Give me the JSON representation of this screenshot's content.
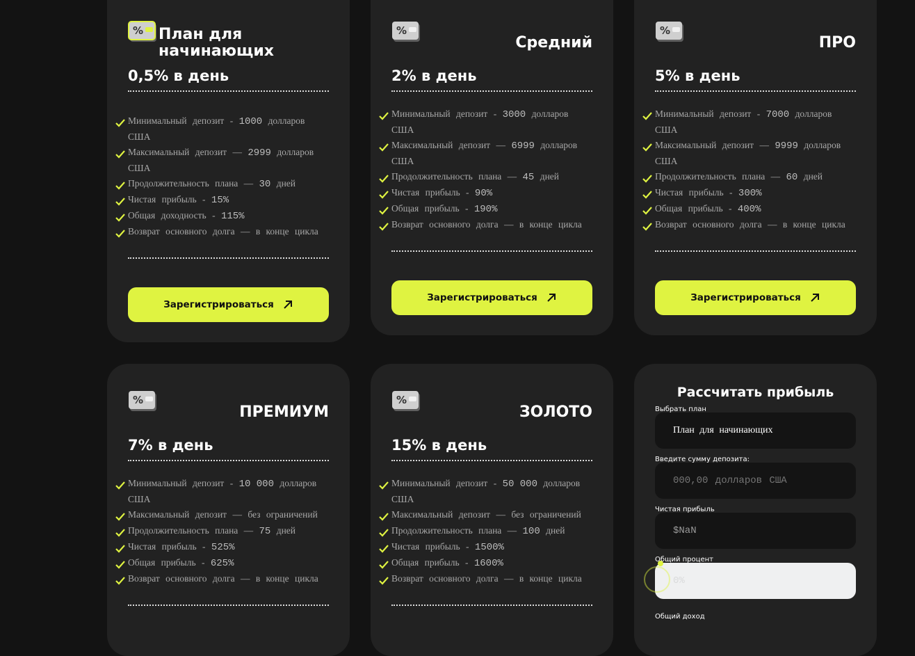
{
  "cta_label": "Зарегистрироваться",
  "accent_color": "#dff341",
  "plans": [
    {
      "name": "План для начинающих",
      "name_lines": [
        "План для",
        "начинающих"
      ],
      "rate": "0,5% в день",
      "features": [
        {
          "text": "Минимальный депозит - ",
          "value": "1000",
          "suffix": " долларов США"
        },
        {
          "text": "Максимальный депозит — ",
          "value": "2999",
          "suffix": " долларов США"
        },
        {
          "text": "Продолжительность плана — ",
          "value": "30",
          "suffix": " дней"
        },
        {
          "text": "Чистая прибыль - ",
          "value": "15%",
          "suffix": ""
        },
        {
          "text": "Общая доходность - ",
          "value": "115%",
          "suffix": ""
        },
        {
          "text": "Возврат основного долга — в конце цикла",
          "value": "",
          "suffix": ""
        }
      ]
    },
    {
      "name": "Средний",
      "rate": "2% в день",
      "features": [
        {
          "text": "Минимальный депозит - ",
          "value": "3000",
          "suffix": " долларов США"
        },
        {
          "text": "Максимальный депозит — ",
          "value": "6999",
          "suffix": " долларов США"
        },
        {
          "text": "Продолжительность плана — ",
          "value": "45",
          "suffix": " дней"
        },
        {
          "text": "Чистая прибыль - ",
          "value": "90%",
          "suffix": ""
        },
        {
          "text": "Общая прибыль - ",
          "value": "190%",
          "suffix": ""
        },
        {
          "text": "Возврат основного долга — в конце цикла",
          "value": "",
          "suffix": ""
        }
      ]
    },
    {
      "name": "ПРО",
      "rate": "5% в день",
      "features": [
        {
          "text": "Минимальный депозит - ",
          "value": "7000",
          "suffix": " долларов США"
        },
        {
          "text": "Максимальный депозит — ",
          "value": "9999",
          "suffix": " долларов США"
        },
        {
          "text": "Продолжительность плана — ",
          "value": "60",
          "suffix": " дней"
        },
        {
          "text": "Чистая прибыль - ",
          "value": "300%",
          "suffix": ""
        },
        {
          "text": "Общая прибыль - ",
          "value": "400%",
          "suffix": ""
        },
        {
          "text": "Возврат основного долга — в конце цикла",
          "value": "",
          "suffix": ""
        }
      ]
    },
    {
      "name": "ПРЕМИУМ",
      "rate": "7% в день",
      "features": [
        {
          "text": "Минимальный депозит - ",
          "value": "10 000",
          "suffix": " долларов США"
        },
        {
          "text": "Максимальный депозит — без ограничений",
          "value": "",
          "suffix": ""
        },
        {
          "text": "Продолжительность плана — ",
          "value": "75",
          "suffix": " дней"
        },
        {
          "text": "Чистая прибыль - ",
          "value": "525%",
          "suffix": ""
        },
        {
          "text": "Общая прибыль - ",
          "value": "625%",
          "suffix": ""
        },
        {
          "text": "Возврат основного долга — в конце цикла",
          "value": "",
          "suffix": ""
        }
      ]
    },
    {
      "name": "ЗОЛОТО",
      "rate": "15% в день",
      "features": [
        {
          "text": "Минимальный депозит - ",
          "value": "50 000",
          "suffix": " долларов США"
        },
        {
          "text": "Максимальный депозит — без ограничений",
          "value": "",
          "suffix": ""
        },
        {
          "text": "Продолжительность плана — ",
          "value": "100",
          "suffix": " дней"
        },
        {
          "text": "Чистая прибыль - ",
          "value": "1500%",
          "suffix": ""
        },
        {
          "text": "Общая прибыль - ",
          "value": "1600%",
          "suffix": ""
        },
        {
          "text": "Возврат основного долга — в конце цикла",
          "value": "",
          "suffix": ""
        }
      ]
    }
  ],
  "calculator": {
    "title": "Рассчитать прибыль",
    "plan_label": "Выбрать план",
    "plan_value": "План для начинающих",
    "deposit_label": "Введите сумму депозита:",
    "deposit_placeholder": "000,00 долларов США",
    "profit_label": "Чистая прибыль",
    "profit_value": "$NaN",
    "percent_label": "Общий процент",
    "percent_value": "0%",
    "income_label": "Общий доход"
  }
}
